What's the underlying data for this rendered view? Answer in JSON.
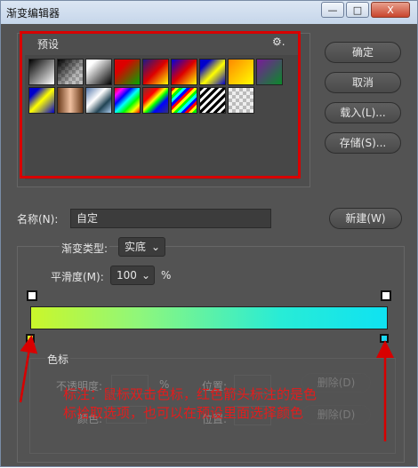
{
  "window": {
    "title": "渐变编辑器",
    "minimize": "—",
    "maximize": "□",
    "close": "X"
  },
  "presets": {
    "label": "预设",
    "settings_icon": "gear-icon",
    "settings_glyph": "⚙."
  },
  "buttons": {
    "ok": "确定",
    "cancel": "取消",
    "load": "载入(L)...",
    "save": "存储(S)...",
    "new": "新建(W)"
  },
  "name_row": {
    "label": "名称(N):",
    "value": "自定"
  },
  "gradient_type": {
    "label": "渐变类型:",
    "value": "实底"
  },
  "smoothness": {
    "label": "平滑度(M):",
    "value": "100",
    "unit": "%"
  },
  "stops": {
    "group_label": "色标",
    "left_color": "#d9ef25",
    "right_color": "#19d8f3"
  },
  "stops_panel": {
    "opacity_label": "不透明度:",
    "opacity_unit": "%",
    "location_label": "位置:",
    "delete": "删除(D)",
    "color_label": "颜色:",
    "location_label2": "位置:",
    "delete2": "删除(D)"
  },
  "annotation": {
    "line1": "标注：鼠标双击色标，红色箭头标注的是色",
    "line2": "标拾取选项，也可以在预设里面选择颜色"
  },
  "colors": {
    "annotation_red": "#d80000"
  }
}
